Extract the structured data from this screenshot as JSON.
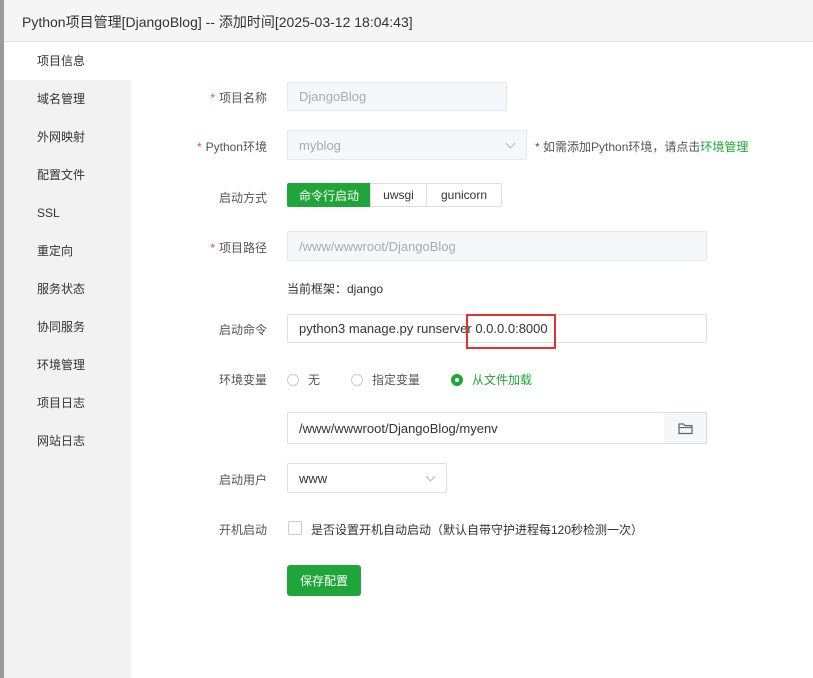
{
  "window": {
    "title": "Python项目管理[DjangoBlog] -- 添加时间[2025-03-12 18:04:43]"
  },
  "sidebar": {
    "items": [
      {
        "label": "项目信息",
        "active": true
      },
      {
        "label": "域名管理"
      },
      {
        "label": "外网映射"
      },
      {
        "label": "配置文件"
      },
      {
        "label": "SSL"
      },
      {
        "label": "重定向"
      },
      {
        "label": "服务状态"
      },
      {
        "label": "协同服务"
      },
      {
        "label": "环境管理"
      },
      {
        "label": "项目日志"
      },
      {
        "label": "网站日志"
      }
    ]
  },
  "form": {
    "required_mark": "*",
    "project_name": {
      "label": "项目名称",
      "value": "DjangoBlog"
    },
    "python_env": {
      "label": "Python环境",
      "value": "myblog",
      "hint_prefix": "* 如需添加Python环境，请点击",
      "hint_link": "环境管理"
    },
    "start_mode": {
      "label": "启动方式",
      "options": [
        "命令行启动",
        "uwsgi",
        "gunicorn"
      ],
      "selected": "命令行启动"
    },
    "project_path": {
      "label": "项目路径",
      "value": "/www/wwwroot/DjangoBlog"
    },
    "framework": {
      "text": "当前框架：django"
    },
    "start_command": {
      "label": "启动命令",
      "value": "python3 manage.py runserver 0.0.0.0:8000"
    },
    "env_vars": {
      "label": "环境变量",
      "options": [
        "无",
        "指定变量",
        "从文件加载"
      ],
      "selected": "从文件加载",
      "file_path": "/www/wwwroot/DjangoBlog/myenv"
    },
    "start_user": {
      "label": "启动用户",
      "value": "www"
    },
    "autostart": {
      "label": "开机启动",
      "text": "是否设置开机自动启动（默认自带守护进程每120秒检测一次）",
      "checked": false
    },
    "save_label": "保存配置"
  },
  "colors": {
    "accent": "#20a53a",
    "highlight_box": "#e03232",
    "required": "#ef4444"
  },
  "icons": {
    "folder": "folder-icon",
    "select": "chevron-down-icon"
  }
}
